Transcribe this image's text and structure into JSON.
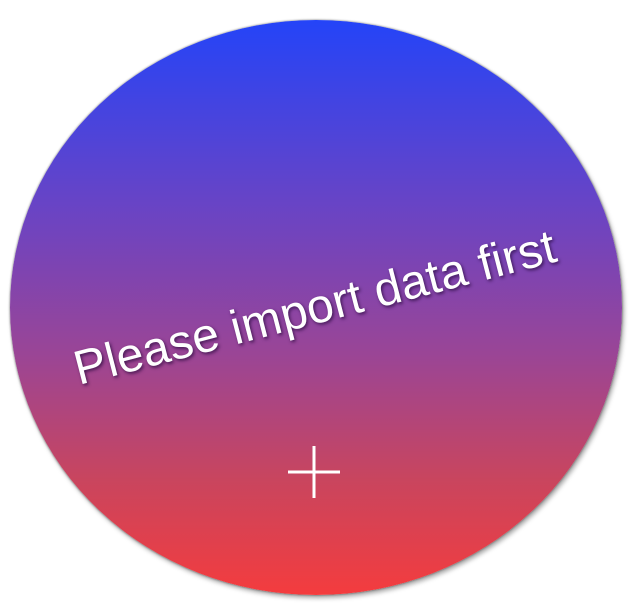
{
  "import_prompt": {
    "message": "Please import data first",
    "add_icon": "plus-icon",
    "colors": {
      "gradient_top": "#2444f8",
      "gradient_bottom": "#f43c3e",
      "text": "#ffffff"
    }
  }
}
